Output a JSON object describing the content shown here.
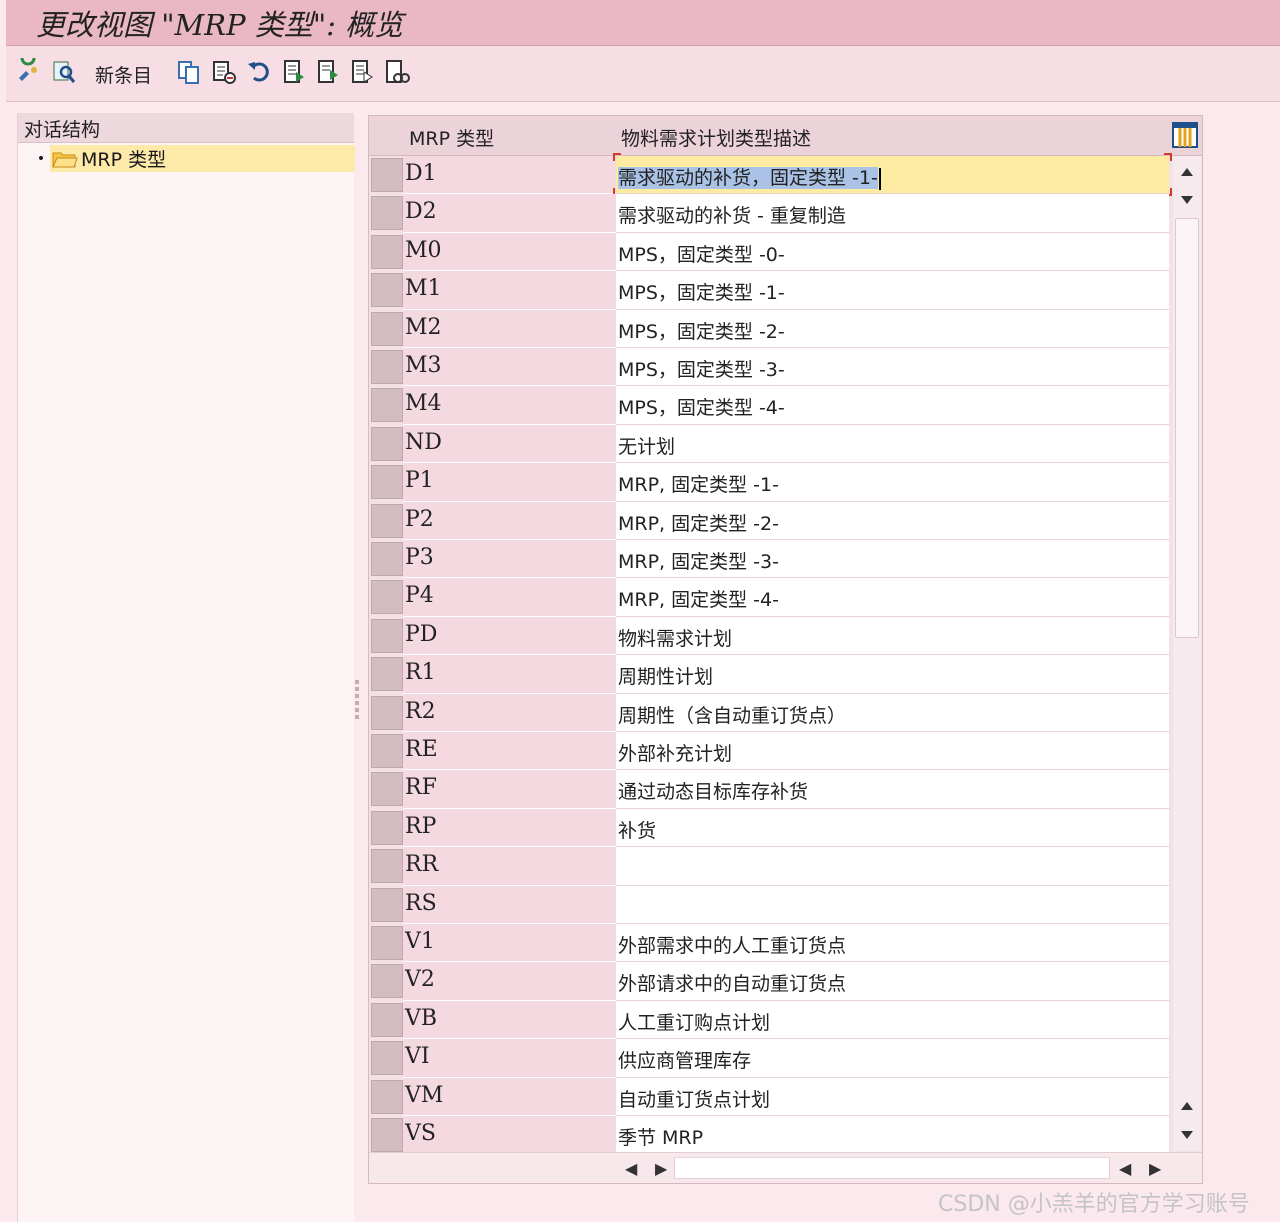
{
  "window": {
    "title": "更改视图 \"MRP 类型\": 概览"
  },
  "toolbar": {
    "new_entries_label": "新条目",
    "icons": [
      "display-change-icon",
      "find-icon",
      "copy-as-icon",
      "delete-icon",
      "undo-icon",
      "select-all-icon",
      "select-block-icon",
      "deselect-all-icon",
      "print-icon"
    ]
  },
  "dialog_structure": {
    "header": "对话结构",
    "items": [
      {
        "label": "MRP 类型",
        "selected": true
      }
    ]
  },
  "table": {
    "headers": {
      "code": "MRP 类型",
      "description": "物料需求计划类型描述"
    },
    "rows": [
      {
        "code": "D1",
        "description": "需求驱动的补货，固定类型 -1-",
        "active": true
      },
      {
        "code": "D2",
        "description": "需求驱动的补货 - 重复制造"
      },
      {
        "code": "M0",
        "description": "MPS，固定类型 -0-"
      },
      {
        "code": "M1",
        "description": "MPS，固定类型 -1-"
      },
      {
        "code": "M2",
        "description": "MPS，固定类型 -2-"
      },
      {
        "code": "M3",
        "description": "MPS，固定类型 -3-"
      },
      {
        "code": "M4",
        "description": "MPS，固定类型 -4-"
      },
      {
        "code": "ND",
        "description": "无计划"
      },
      {
        "code": "P1",
        "description": "MRP, 固定类型 -1-"
      },
      {
        "code": "P2",
        "description": "MRP, 固定类型 -2-"
      },
      {
        "code": "P3",
        "description": "MRP, 固定类型 -3-"
      },
      {
        "code": "P4",
        "description": "MRP, 固定类型 -4-"
      },
      {
        "code": "PD",
        "description": "物料需求计划"
      },
      {
        "code": "R1",
        "description": "周期性计划"
      },
      {
        "code": "R2",
        "description": "周期性（含自动重订货点）"
      },
      {
        "code": "RE",
        "description": "外部补充计划"
      },
      {
        "code": "RF",
        "description": "通过动态目标库存补货"
      },
      {
        "code": "RP",
        "description": "补货"
      },
      {
        "code": "RR",
        "description": ""
      },
      {
        "code": "RS",
        "description": ""
      },
      {
        "code": "V1",
        "description": "外部需求中的人工重订货点"
      },
      {
        "code": "V2",
        "description": "外部请求中的自动重订货点"
      },
      {
        "code": "VB",
        "description": "人工重订购点计划"
      },
      {
        "code": "VI",
        "description": "供应商管理库存"
      },
      {
        "code": "VM",
        "description": "自动重订货点计划"
      },
      {
        "code": "VS",
        "description": "季节 MRP"
      }
    ]
  },
  "watermark": "CSDN @小羔羊的官方学习账号",
  "colors": {
    "title_bar": "#e9b8c4",
    "key_column": "#f5d9e0",
    "active_row": "#fdeba2",
    "selection_highlight": "#a9c2e6"
  }
}
